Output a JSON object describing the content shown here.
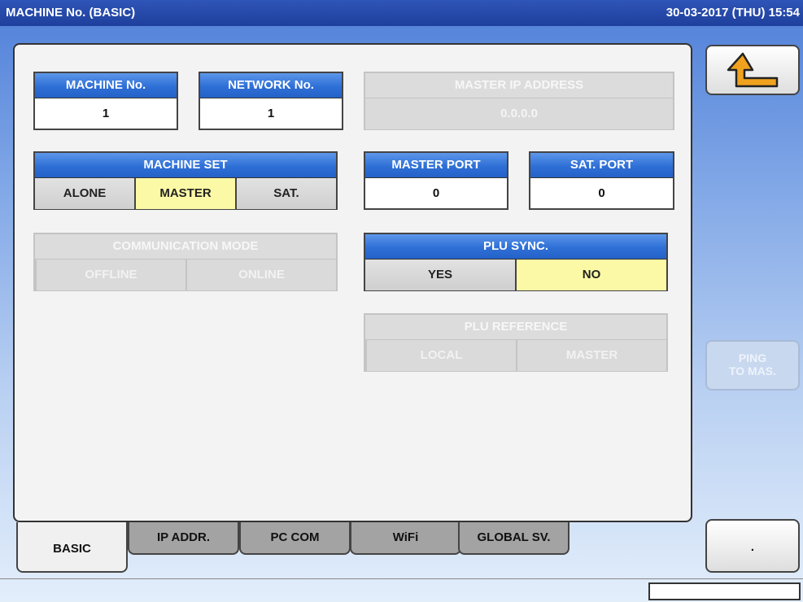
{
  "titlebar": {
    "title": "MACHINE No. (BASIC)",
    "datetime": "30-03-2017 (THU) 15:54"
  },
  "machine_no": {
    "label": "MACHINE No.",
    "value": "1"
  },
  "network_no": {
    "label": "NETWORK No.",
    "value": "1"
  },
  "master_ip": {
    "label": "MASTER IP ADDRESS",
    "value": "0.0.0.0",
    "enabled": false
  },
  "machine_set": {
    "label": "MACHINE SET",
    "options": [
      "ALONE",
      "MASTER",
      "SAT."
    ],
    "selected": "MASTER"
  },
  "master_port": {
    "label": "MASTER PORT",
    "value": "0"
  },
  "sat_port": {
    "label": "SAT. PORT",
    "value": "0"
  },
  "communication_mode": {
    "label": "COMMUNICATION MODE",
    "options": [
      "OFFLINE",
      "ONLINE"
    ],
    "enabled": false
  },
  "plu_sync": {
    "label": "PLU SYNC.",
    "options": [
      "YES",
      "NO"
    ],
    "selected": "NO"
  },
  "plu_reference": {
    "label": "PLU REFERENCE",
    "options": [
      "LOCAL",
      "MASTER"
    ],
    "enabled": false
  },
  "side": {
    "back_icon": "return-arrow-icon",
    "ping_line1": "PING",
    "ping_line2": "TO MAS.",
    "dot_label": "."
  },
  "tabs": [
    {
      "label": "BASIC",
      "active": true
    },
    {
      "label": "IP ADDR.",
      "active": false
    },
    {
      "label": "PC COM",
      "active": false
    },
    {
      "label": "WiFi",
      "active": false
    },
    {
      "label": "GLOBAL SV.",
      "active": false
    }
  ],
  "colors": {
    "header_blue": "#2e6fd6",
    "selected_yellow": "#fbf9a6",
    "arrow_orange": "#f0a21e"
  }
}
